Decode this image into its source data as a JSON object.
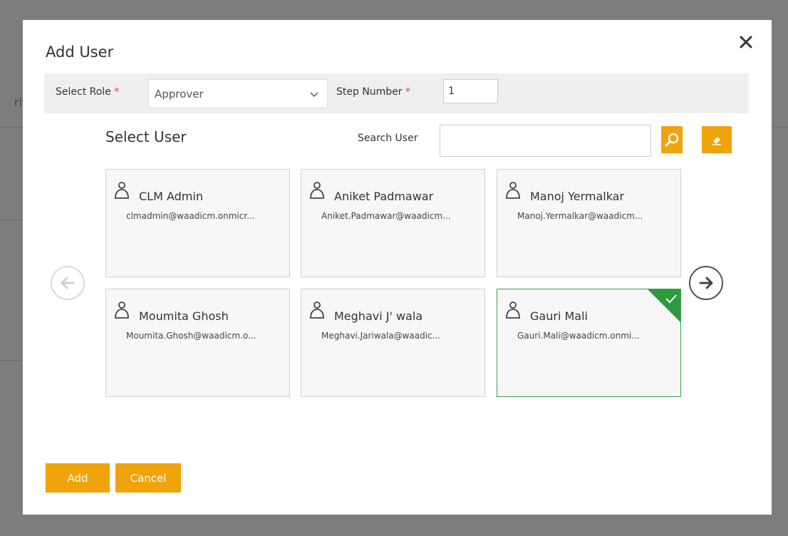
{
  "background": {
    "partial_text": "rif"
  },
  "modal": {
    "title": "Add User",
    "close_icon": "close-icon"
  },
  "role_bar": {
    "role_label": "Select Role",
    "role_required": "*",
    "role_value": "Approver",
    "step_label": "Step Number",
    "step_required": "*",
    "step_value": "1"
  },
  "user_picker": {
    "title": "Select User",
    "search_label": "Search User",
    "search_value": "",
    "search_icon": "search-icon",
    "clear_icon": "eraser-icon",
    "prev_icon": "arrow-left-icon",
    "next_icon": "arrow-right-icon"
  },
  "users": [
    {
      "name": "CLM Admin",
      "email": "clmadmin@waadicm.onmicr...",
      "selected": false
    },
    {
      "name": "Aniket Padmawar",
      "email": "Aniket.Padmawar@waadicm...",
      "selected": false
    },
    {
      "name": "Manoj Yermalkar",
      "email": "Manoj.Yermalkar@waadicm...",
      "selected": false
    },
    {
      "name": "Moumita Ghosh",
      "email": "Moumita.Ghosh@waadicm.o...",
      "selected": false
    },
    {
      "name": "Meghavi J' wala",
      "email": "Meghavi.Jariwala@waadic...",
      "selected": false
    },
    {
      "name": "Gauri Mali",
      "email": "Gauri.Mali@waadicm.onmi...",
      "selected": true
    }
  ],
  "footer": {
    "add_label": "Add",
    "cancel_label": "Cancel"
  },
  "colors": {
    "accent": "#f0a30a",
    "selected_border": "#3aa04a",
    "required": "#e0433b"
  }
}
